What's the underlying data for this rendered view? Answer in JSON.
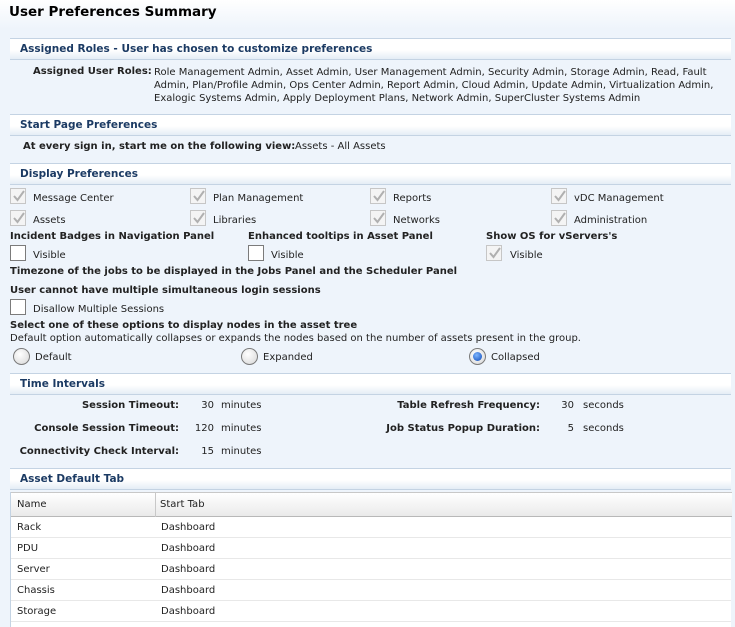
{
  "page": {
    "title": "User Preferences Summary"
  },
  "assigned_roles": {
    "header": "Assigned Roles - User has chosen to customize preferences",
    "label": "Assigned User Roles:",
    "value": "Role Management Admin, Asset Admin, User Management Admin, Security Admin, Storage Admin, Read, Fault Admin, Plan/Profile Admin, Ops Center Admin, Report Admin, Cloud Admin, Update Admin, Virtualization Admin, Exalogic Systems Admin, Apply Deployment Plans, Network Admin, SuperCluster Systems Admin"
  },
  "start_page": {
    "header": "Start Page Preferences",
    "label": "At every sign in, start me on the following view:",
    "value": "Assets - All Assets"
  },
  "display": {
    "header": "Display Preferences",
    "items": [
      {
        "label": "Message Center",
        "checked": true
      },
      {
        "label": "Plan Management",
        "checked": true
      },
      {
        "label": "Reports",
        "checked": true
      },
      {
        "label": "vDC Management",
        "checked": true
      },
      {
        "label": "Assets",
        "checked": true
      },
      {
        "label": "Libraries",
        "checked": true
      },
      {
        "label": "Networks",
        "checked": true
      },
      {
        "label": "Administration",
        "checked": true
      }
    ],
    "incident_badges": {
      "title": "Incident Badges in Navigation Panel",
      "option": "Visible",
      "checked": false
    },
    "enhanced_tooltips": {
      "title": "Enhanced tooltips in Asset Panel",
      "option": "Visible",
      "checked": false
    },
    "show_os": {
      "title": "Show OS for vServers's",
      "option": "Visible",
      "checked": true
    },
    "timezone_title": "Timezone of the jobs to be displayed in the Jobs Panel and the Scheduler Panel",
    "sessions": {
      "title": "User cannot have multiple simultaneous login sessions",
      "option": "Disallow Multiple Sessions",
      "checked": false
    },
    "asset_tree": {
      "title": "Select one of these options to display nodes in the asset tree",
      "description": "Default option automatically collapses or expands the nodes based on the number of assets present in the group.",
      "options": [
        "Default",
        "Expanded",
        "Collapsed"
      ],
      "selected": "Collapsed"
    }
  },
  "time_intervals": {
    "header": "Time Intervals",
    "session_timeout": {
      "label": "Session Timeout:",
      "value": "30",
      "unit": "minutes"
    },
    "console_timeout": {
      "label": "Console Session Timeout:",
      "value": "120",
      "unit": "minutes"
    },
    "connectivity_check": {
      "label": "Connectivity Check Interval:",
      "value": "15",
      "unit": "minutes"
    },
    "table_refresh": {
      "label": "Table Refresh Frequency:",
      "value": "30",
      "unit": "seconds"
    },
    "job_status_popup": {
      "label": "Job Status Popup Duration:",
      "value": "5",
      "unit": "seconds"
    }
  },
  "asset_default_tab": {
    "header": "Asset Default Tab",
    "columns": [
      "Name",
      "Start Tab"
    ],
    "rows": [
      [
        "Rack",
        "Dashboard"
      ],
      [
        "PDU",
        "Dashboard"
      ],
      [
        "Server",
        "Dashboard"
      ],
      [
        "Chassis",
        "Dashboard"
      ],
      [
        "Storage",
        "Dashboard"
      ]
    ]
  },
  "colors": {
    "section_title": "#1b3a63",
    "page_background": "#eef4fb",
    "check_mark": "#b0b0b0",
    "radio_selected": "#0b48b7"
  }
}
